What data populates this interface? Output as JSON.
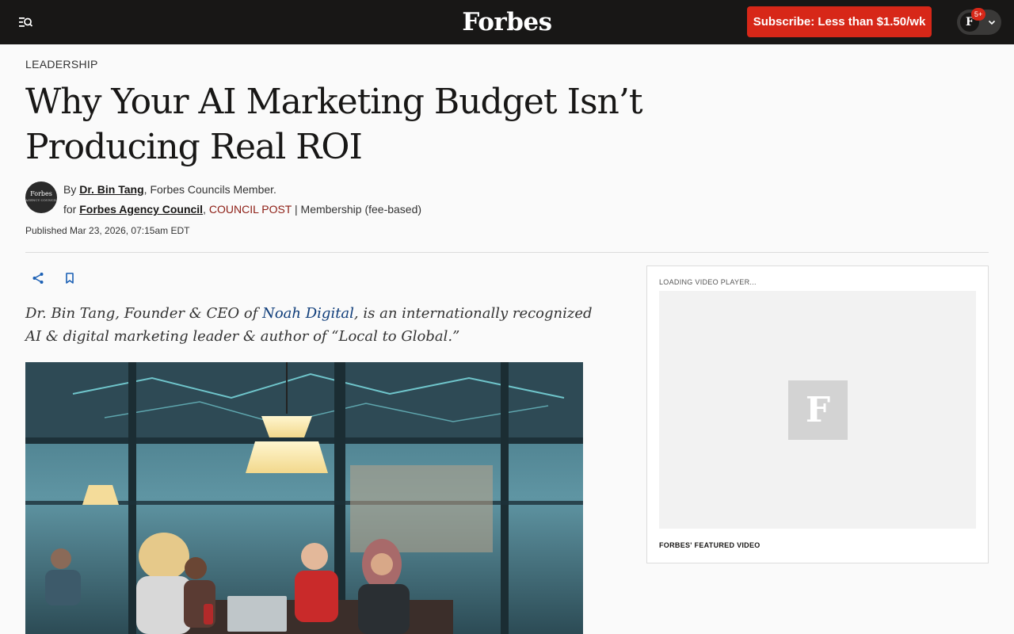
{
  "header": {
    "logo": "Forbes",
    "subscribe_label": "Subscribe: Less than $1.50/wk",
    "account_initial": "F",
    "notification_count": "5+"
  },
  "article": {
    "section": "LEADERSHIP",
    "headline": "Why Your AI Marketing Budget Isn’t Producing Real ROI",
    "byline": {
      "by": "By",
      "author": "Dr. Bin Tang",
      "author_role": "Forbes Councils Member.",
      "for": "for",
      "council": "Forbes Agency Council",
      "council_post": "COUNCIL POST",
      "membership": "| Membership (fee-based)",
      "avatar_text": "Forbes",
      "avatar_subtext": "AGENCY COUNCIL"
    },
    "published": "Published Mar 23, 2026, 07:15am EDT",
    "bio": {
      "before": "Dr. Bin Tang, Founder & CEO of ",
      "link": "Noah Digital",
      "after": ", is an internationally recognized AI & digital marketing leader & author of “Local to Global.”"
    }
  },
  "video": {
    "loading": "LOADING VIDEO PLAYER...",
    "logo_letter": "F",
    "caption": "FORBES' FEATURED VIDEO"
  },
  "colors": {
    "nav_bg": "#181716",
    "subscribe_bg": "#d72718",
    "council_post": "#8c1c13",
    "link_blue": "#0f3d7a"
  },
  "icons": [
    "search-menu-icon",
    "chevron-down-icon",
    "share-icon",
    "bookmark-icon"
  ]
}
